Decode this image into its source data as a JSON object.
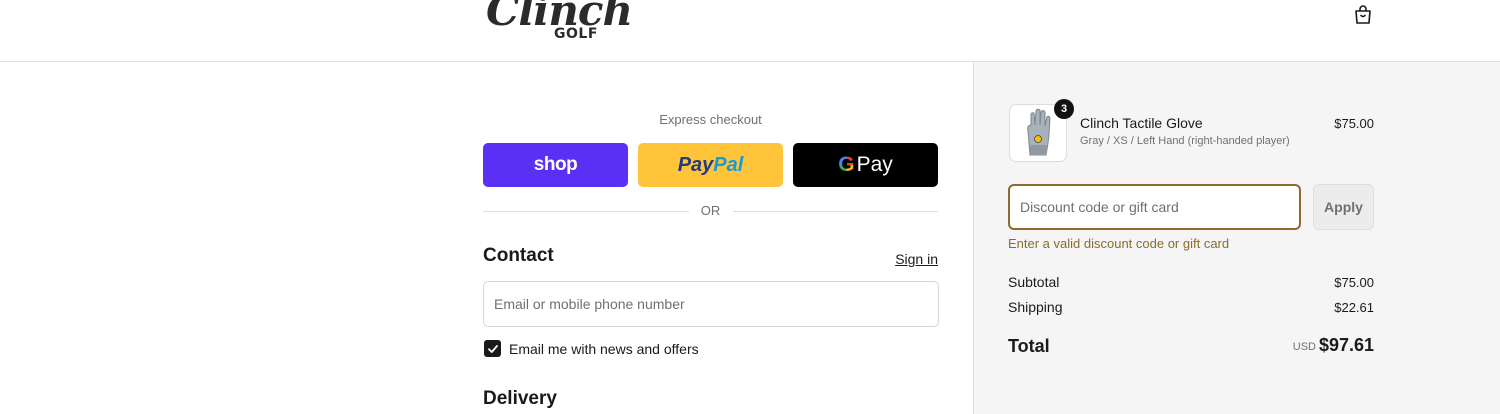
{
  "brand": {
    "script": "Clinch",
    "sub": "GOLF"
  },
  "express": {
    "title": "Express checkout",
    "shop_label": "shop",
    "paypal_part1": "Pay",
    "paypal_part2": "Pal",
    "gpay_g": "G",
    "gpay_label": "Pay",
    "or_text": "OR"
  },
  "contact": {
    "title": "Contact",
    "signin_label": "Sign in",
    "email_placeholder": "Email or mobile phone number",
    "newsletter_label": "Email me with news and offers",
    "newsletter_checked": true
  },
  "delivery": {
    "title": "Delivery"
  },
  "order": {
    "item": {
      "name": "Clinch Tactile Glove",
      "variant": "Gray / XS / Left Hand (right-handed player)",
      "price": "$75.00",
      "quantity": "3"
    },
    "discount_placeholder": "Discount code or gift card",
    "apply_label": "Apply",
    "discount_error": "Enter a valid discount code or gift card",
    "subtotal_label": "Subtotal",
    "subtotal_value": "$75.00",
    "shipping_label": "Shipping",
    "shipping_value": "$22.61",
    "total_label": "Total",
    "total_currency": "USD",
    "total_value": "$97.61"
  },
  "colors": {
    "shop": "#5a31f4",
    "paypal": "#ffc439",
    "gpay": "#000000",
    "accent_error": "#8c6b2f"
  }
}
